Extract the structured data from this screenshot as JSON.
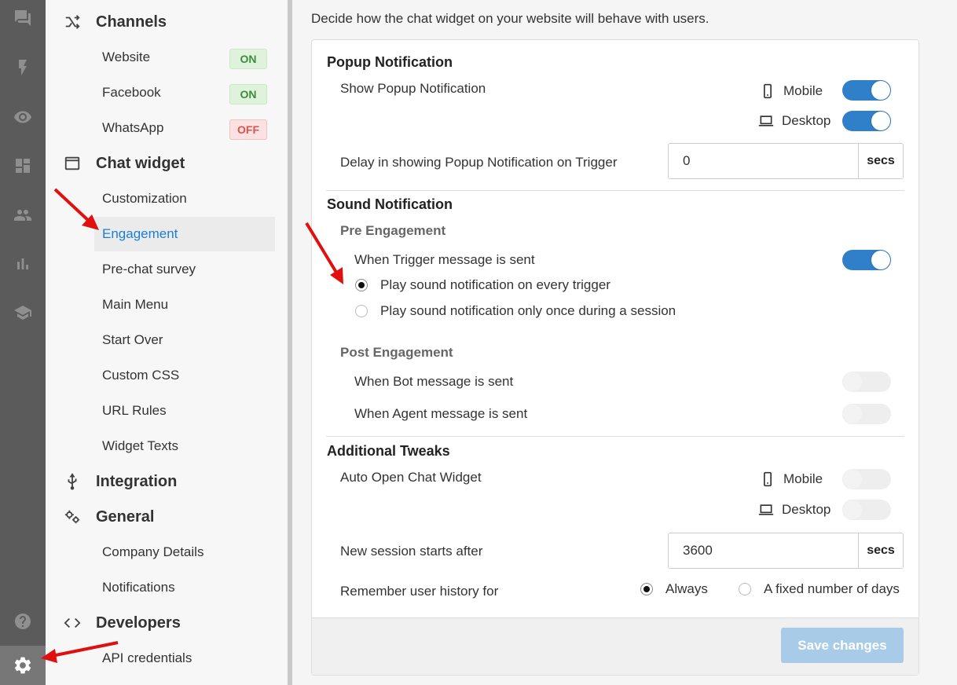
{
  "rail": {
    "icons": [
      "chat-icon",
      "bolt-icon",
      "eye-icon",
      "dashboard-icon",
      "people-icon",
      "bar-chart-icon",
      "school-icon",
      "help-icon",
      "settings-icon"
    ]
  },
  "nav": {
    "channels": {
      "title": "Channels",
      "items": [
        {
          "label": "Website",
          "badge": "ON"
        },
        {
          "label": "Facebook",
          "badge": "ON"
        },
        {
          "label": "WhatsApp",
          "badge": "OFF"
        }
      ]
    },
    "chat_widget": {
      "title": "Chat widget",
      "items": [
        "Customization",
        "Engagement",
        "Pre-chat survey",
        "Main Menu",
        "Start Over",
        "Custom CSS",
        "URL Rules",
        "Widget Texts"
      ],
      "active": "Engagement"
    },
    "integration": {
      "title": "Integration"
    },
    "general": {
      "title": "General",
      "items": [
        "Company Details",
        "Notifications"
      ]
    },
    "developers": {
      "title": "Developers",
      "items": [
        "API credentials"
      ]
    }
  },
  "main": {
    "description": "Decide how the chat widget on your website will behave with users.",
    "popup": {
      "heading": "Popup Notification",
      "show_label": "Show Popup Notification",
      "mobile_label": "Mobile",
      "desktop_label": "Desktop",
      "mobile_on": true,
      "desktop_on": true,
      "delay_label": "Delay in showing Popup Notification on Trigger",
      "delay_value": "0",
      "delay_unit": "secs"
    },
    "sound": {
      "heading": "Sound Notification",
      "pre_heading": "Pre Engagement",
      "trigger_label": "When Trigger message is sent",
      "trigger_on": true,
      "radio_every": "Play sound notification on every trigger",
      "radio_once": "Play sound notification only once during a session",
      "selected": "every",
      "post_heading": "Post Engagement",
      "bot_label": "When Bot message is sent",
      "agent_label": "When Agent message is sent",
      "bot_on": false,
      "agent_on": false
    },
    "tweaks": {
      "heading": "Additional Tweaks",
      "auto_open_label": "Auto Open Chat Widget",
      "mobile_label": "Mobile",
      "desktop_label": "Desktop",
      "mobile_on": false,
      "desktop_on": false,
      "session_label": "New session starts after",
      "session_value": "3600",
      "session_unit": "secs",
      "history_label": "Remember user history for",
      "history_always": "Always",
      "history_fixed": "A fixed number of days",
      "history_selected": "always"
    },
    "save_label": "Save changes"
  },
  "colors": {
    "accent": "#2f7fc9",
    "active_link": "#1a7fd6",
    "annotation_arrow": "#e01010"
  }
}
